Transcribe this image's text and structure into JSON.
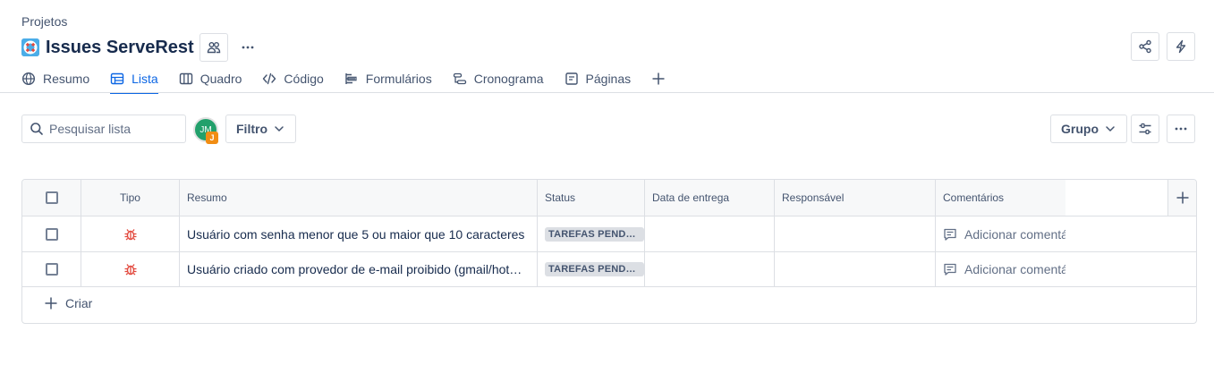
{
  "breadcrumb": "Projetos",
  "project": {
    "title": "Issues ServeRest",
    "icon": "lifebuoy-icon",
    "icon_color": "#4bade8"
  },
  "tabs": [
    {
      "label": "Resumo",
      "icon": "globe-icon",
      "active": false
    },
    {
      "label": "Lista",
      "icon": "list-table-icon",
      "active": true
    },
    {
      "label": "Quadro",
      "icon": "board-icon",
      "active": false
    },
    {
      "label": "Código",
      "icon": "code-icon",
      "active": false
    },
    {
      "label": "Formulários",
      "icon": "form-icon",
      "active": false
    },
    {
      "label": "Cronograma",
      "icon": "timeline-icon",
      "active": false
    },
    {
      "label": "Páginas",
      "icon": "page-icon",
      "active": false
    }
  ],
  "toolbar": {
    "search_placeholder": "Pesquisar lista",
    "avatar_initials": "JM",
    "avatar_badge": "J",
    "filter_label": "Filtro",
    "group_label": "Grupo"
  },
  "table": {
    "columns": [
      "Tipo",
      "Resumo",
      "Status",
      "Data de entrega",
      "Responsável",
      "Comentários"
    ],
    "rows": [
      {
        "type": "bug-icon",
        "resumo": "Usuário com senha menor que 5 ou maior que 10 caracteres",
        "status": "TAREFAS PENDENTES",
        "data_entrega": "",
        "responsavel": "",
        "comentarios": "Adicionar comentário"
      },
      {
        "type": "bug-icon",
        "resumo": "Usuário criado com provedor de e-mail proibido (gmail/hotmail)",
        "status": "TAREFAS PENDENTES",
        "data_entrega": "",
        "responsavel": "",
        "comentarios": "Adicionar comentário"
      }
    ],
    "create_label": "Criar"
  },
  "colors": {
    "accent": "#0c66e4",
    "bug": "#e2483d",
    "border": "#dcdfe4"
  }
}
